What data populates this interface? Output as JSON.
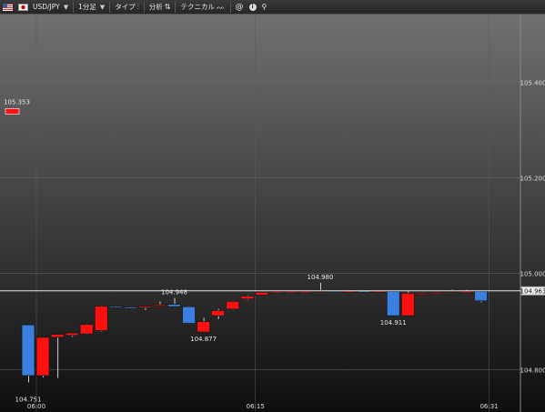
{
  "toolbar": {
    "pair": "USD/JPY",
    "timeframe": "1分足",
    "type_label": "タイプ",
    "analysis_label": "分析",
    "technical_label": "テクニカル"
  },
  "colors": {
    "up": "#ff1010",
    "down": "#3a7ee0",
    "outline": "#1a1a1a"
  },
  "chart_data": {
    "type": "candlestick",
    "ylim": [
      104.71,
      105.54
    ],
    "yticks": [
      "105.400",
      "105.200",
      "105.000",
      "104.800"
    ],
    "xticks": [
      {
        "index": 0,
        "label": "06:00"
      },
      {
        "index": 15,
        "label": "06:15"
      },
      {
        "index": 31,
        "label": "06:31"
      }
    ],
    "candles": [
      {
        "o": 104.892,
        "h": 104.892,
        "l": 104.772,
        "c": 104.786
      },
      {
        "o": 104.786,
        "h": 104.866,
        "l": 104.782,
        "c": 104.866
      },
      {
        "o": 104.866,
        "h": 104.869,
        "l": 104.781,
        "c": 104.872
      },
      {
        "o": 104.87,
        "h": 104.874,
        "l": 104.867,
        "c": 104.875
      },
      {
        "o": 104.873,
        "h": 104.894,
        "l": 104.872,
        "c": 104.893
      },
      {
        "o": 104.88,
        "h": 104.932,
        "l": 104.878,
        "c": 104.931
      },
      {
        "o": 104.931,
        "h": 104.932,
        "l": 104.929,
        "c": 104.93
      },
      {
        "o": 104.929,
        "h": 104.93,
        "l": 104.926,
        "c": 104.926
      },
      {
        "o": 104.928,
        "h": 104.931,
        "l": 104.923,
        "c": 104.931
      },
      {
        "o": 104.931,
        "h": 104.941,
        "l": 104.93,
        "c": 104.934
      },
      {
        "o": 104.935,
        "h": 104.948,
        "l": 104.932,
        "c": 104.93
      },
      {
        "o": 104.93,
        "h": 104.931,
        "l": 104.894,
        "c": 104.895
      },
      {
        "o": 104.877,
        "h": 104.907,
        "l": 104.877,
        "c": 104.899
      },
      {
        "o": 104.911,
        "h": 104.925,
        "l": 104.904,
        "c": 104.922
      },
      {
        "o": 104.925,
        "h": 104.942,
        "l": 104.924,
        "c": 104.941
      },
      {
        "o": 104.946,
        "h": 104.954,
        "l": 104.944,
        "c": 104.952
      },
      {
        "o": 104.954,
        "h": 104.961,
        "l": 104.953,
        "c": 104.96
      },
      {
        "o": 104.961,
        "h": 104.962,
        "l": 104.96,
        "c": 104.961
      },
      {
        "o": 104.962,
        "h": 104.962,
        "l": 104.961,
        "c": 104.962
      },
      {
        "o": 104.962,
        "h": 104.962,
        "l": 104.961,
        "c": 104.962
      },
      {
        "o": 104.962,
        "h": 104.98,
        "l": 104.962,
        "c": 104.964
      },
      {
        "o": 104.964,
        "h": 104.964,
        "l": 104.963,
        "c": 104.963
      },
      {
        "o": 104.963,
        "h": 104.964,
        "l": 104.963,
        "c": 104.963
      },
      {
        "o": 104.963,
        "h": 104.964,
        "l": 104.962,
        "c": 104.962
      },
      {
        "o": 104.962,
        "h": 104.963,
        "l": 104.962,
        "c": 104.963
      },
      {
        "o": 104.962,
        "h": 104.963,
        "l": 104.911,
        "c": 104.911
      },
      {
        "o": 104.911,
        "h": 104.962,
        "l": 104.911,
        "c": 104.958
      },
      {
        "o": 104.958,
        "h": 104.959,
        "l": 104.958,
        "c": 104.958
      },
      {
        "o": 104.96,
        "h": 104.961,
        "l": 104.959,
        "c": 104.96
      },
      {
        "o": 104.962,
        "h": 104.966,
        "l": 104.961,
        "c": 104.964
      },
      {
        "o": 104.962,
        "h": 104.965,
        "l": 104.961,
        "c": 104.962
      },
      {
        "o": 104.962,
        "h": 104.962,
        "l": 104.939,
        "c": 104.942
      }
    ],
    "annotations": [
      {
        "index": 0,
        "value": 104.751,
        "label": "104.751",
        "pos": "below"
      },
      {
        "index": 12,
        "value": 104.877,
        "label": "104.877",
        "pos": "below"
      },
      {
        "index": 10,
        "value": 104.948,
        "label": "104.948",
        "pos": "above"
      },
      {
        "index": 20,
        "value": 104.98,
        "label": "104.980",
        "pos": "above"
      },
      {
        "index": 25,
        "value": 104.911,
        "label": "104.911",
        "pos": "below"
      }
    ],
    "high_marker": {
      "label": "105.353",
      "value": 105.353
    },
    "current_price": {
      "label": "104.963",
      "value": 104.963
    }
  }
}
